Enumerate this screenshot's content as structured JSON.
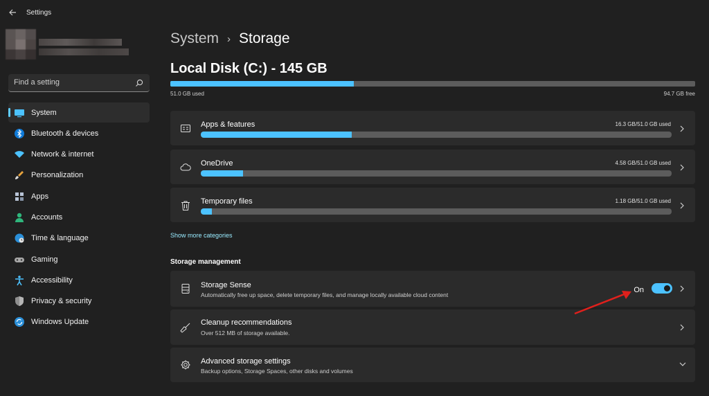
{
  "window": {
    "title": "Settings"
  },
  "sidebar": {
    "search": {
      "placeholder": "Find a setting"
    },
    "items": [
      {
        "label": "System",
        "icon": "system-icon",
        "active": true
      },
      {
        "label": "Bluetooth & devices",
        "icon": "bluetooth-icon"
      },
      {
        "label": "Network & internet",
        "icon": "network-icon"
      },
      {
        "label": "Personalization",
        "icon": "brush-icon"
      },
      {
        "label": "Apps",
        "icon": "apps-icon"
      },
      {
        "label": "Accounts",
        "icon": "accounts-icon"
      },
      {
        "label": "Time & language",
        "icon": "globe-clock-icon"
      },
      {
        "label": "Gaming",
        "icon": "gamepad-icon"
      },
      {
        "label": "Accessibility",
        "icon": "accessibility-icon"
      },
      {
        "label": "Privacy & security",
        "icon": "shield-icon"
      },
      {
        "label": "Windows Update",
        "icon": "update-icon"
      }
    ]
  },
  "header": {
    "parent": "System",
    "separator": "›",
    "current": "Storage"
  },
  "disk": {
    "title": "Local Disk (C:) - 145 GB",
    "used_label": "51.0 GB used",
    "free_label": "94.7 GB free",
    "used_fraction": 0.35
  },
  "categories": [
    {
      "title": "Apps & features",
      "size": "16.3 GB/51.0 GB used",
      "fraction": 0.32,
      "icon": "apps-features-icon"
    },
    {
      "title": "OneDrive",
      "size": "4.58 GB/51.0 GB used",
      "fraction": 0.09,
      "icon": "cloud-icon"
    },
    {
      "title": "Temporary files",
      "size": "1.18 GB/51.0 GB used",
      "fraction": 0.023,
      "icon": "trash-icon"
    }
  ],
  "show_more": "Show more categories",
  "management": {
    "header": "Storage management",
    "storage_sense": {
      "title": "Storage Sense",
      "desc": "Automatically free up space, delete temporary files, and manage locally available cloud content",
      "toggle_label": "On",
      "toggle_on": true
    },
    "cleanup": {
      "title": "Cleanup recommendations",
      "desc": "Over 512 MB of storage available."
    },
    "advanced": {
      "title": "Advanced storage settings",
      "desc": "Backup options, Storage Spaces, other disks and volumes"
    }
  },
  "colors": {
    "accent": "#4cc2ff",
    "background": "#202020",
    "card": "#2b2b2b",
    "annotation": "#e0201c"
  }
}
